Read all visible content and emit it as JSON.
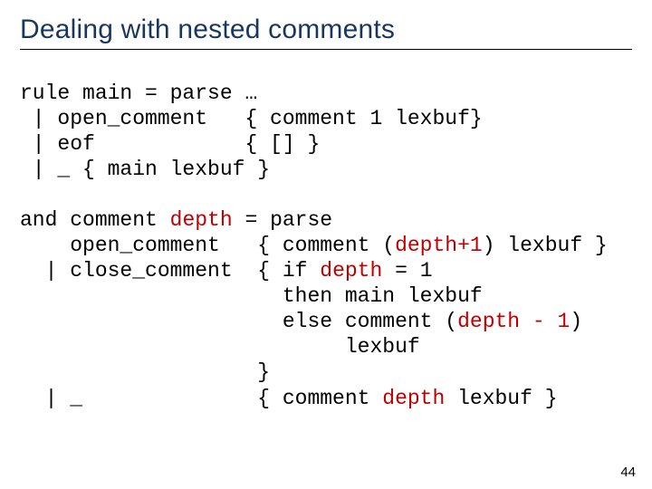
{
  "title": "Dealing with nested comments",
  "code": {
    "l1": "rule main = parse …",
    "l2": " | open_comment   { comment 1 lexbuf}",
    "l3": " | eof            { [] }",
    "l4": " | _ { main lexbuf }",
    "l5a": "and comment ",
    "l5b": "depth",
    "l5c": " = parse",
    "l6a": "    open_comment   { comment (",
    "l6b": "depth+1",
    "l6c": ") lexbuf }",
    "l7a": "  | close_comment  { if ",
    "l7b": "depth",
    "l7c": " = 1",
    "l8": "                     then main lexbuf",
    "l9a": "                     else comment (",
    "l9b": "depth - 1",
    "l9c": ")",
    "l10": "                          lexbuf",
    "l11": "                   }",
    "l12a": "  | _              { comment ",
    "l12b": "depth",
    "l12c": " lexbuf }"
  },
  "page_number": "44"
}
